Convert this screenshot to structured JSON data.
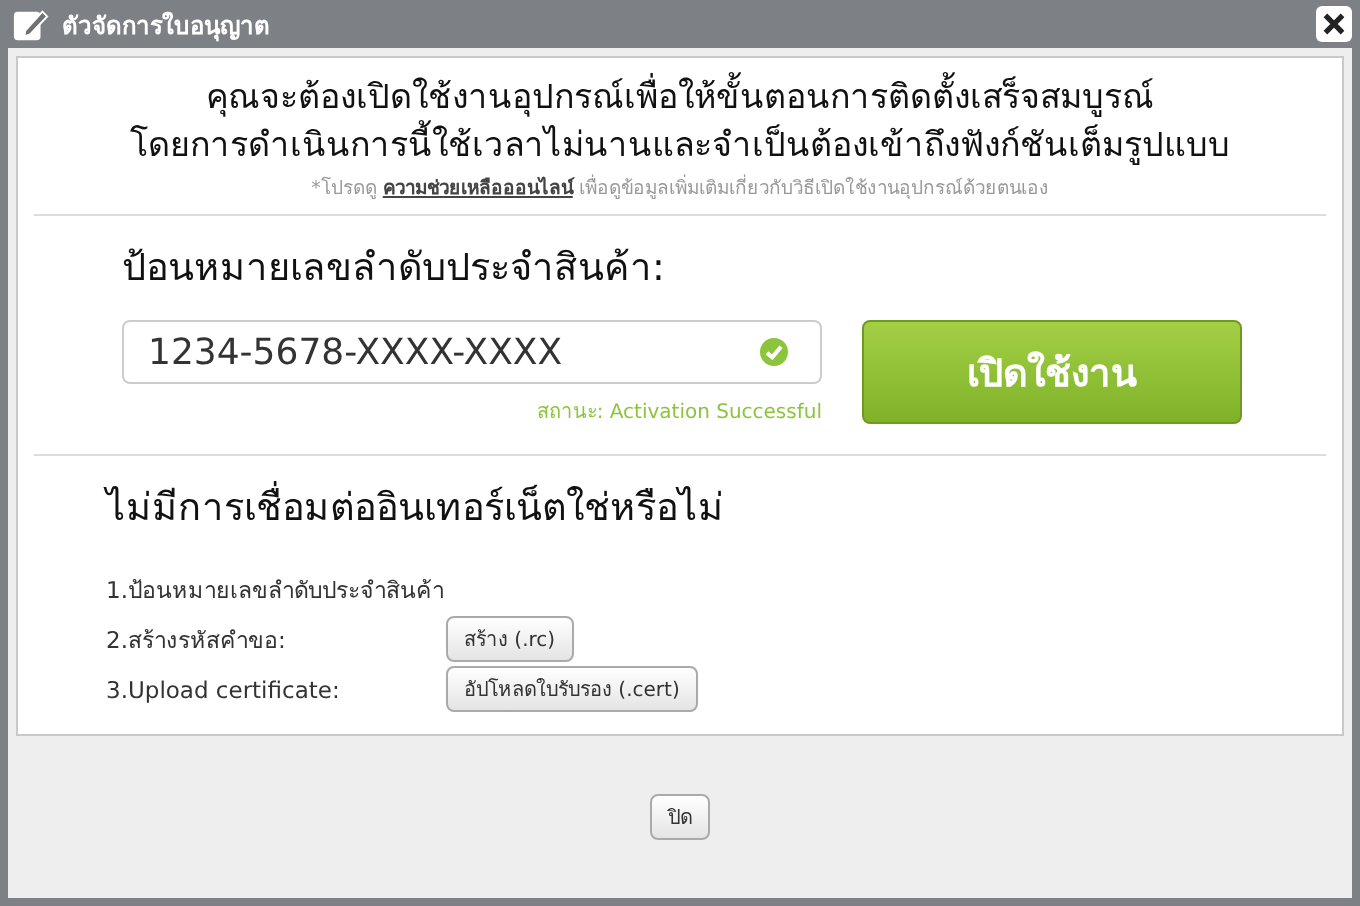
{
  "window": {
    "title": "ตัวจัดการใบอนุญาต"
  },
  "intro": {
    "lines": [
      "คุณจะต้องเปิดใช้งานอุปกรณ์เพื่อให้ขั้นตอนการติดตั้งเสร็จสมบูรณ์",
      "โดยการดำเนินการนี้ใช้เวลาไม่นานและจำเป็นต้องเข้าถึงฟังก์ชันเต็มรูปแบบ"
    ],
    "help": {
      "before": "*โปรดดู",
      "link": "ความช่วยเหลือออนไลน์",
      "after": "เพื่อดูข้อมูลเพิ่มเติมเกี่ยวกับวิธีเปิดใช้งานอุปกรณ์ด้วยตนเอง"
    }
  },
  "serial": {
    "heading": "ป้อนหมายเลขลำดับประจำสินค้า:",
    "value": "1234-5678-XXXX-XXXX",
    "valid": true,
    "status": "สถานะ: Activation Successful",
    "button": "เปิดใช้งาน"
  },
  "offline": {
    "heading": "ไม่มีการเชื่อมต่ออินเทอร์เน็ตใช่หรือไม่",
    "steps": [
      {
        "kind": "text",
        "label": "1.ป้อนหมายเลขลำดับประจำสินค้า"
      },
      {
        "kind": "button",
        "label": "2.สร้างรหัสคำขอ:",
        "button": "สร้าง (.rc)"
      },
      {
        "kind": "button",
        "label": "3.Upload certificate:",
        "button": "อัปโหลดใบรับรอง (.cert)"
      }
    ]
  },
  "footer": {
    "button": "ปิด"
  }
}
